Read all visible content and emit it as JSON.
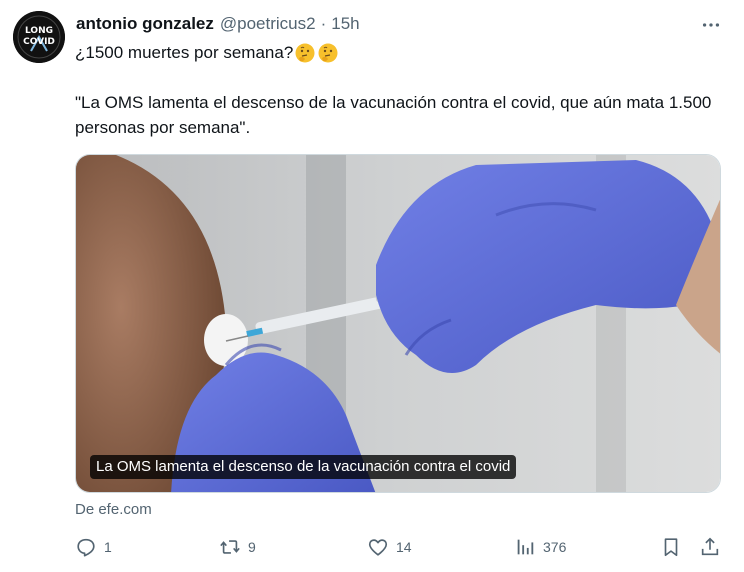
{
  "author": {
    "display_name": "antonio gonzalez",
    "handle": "@poetricus2",
    "separator": "·",
    "time": "15h",
    "avatar_lines": [
      "LONG",
      "COVID"
    ]
  },
  "tweet": {
    "line1": "¿1500 muertes por semana?",
    "line1_emojis": [
      "thinking-face",
      "thinking-face"
    ],
    "quote": "\"La OMS lamenta el descenso de la vacunación contra el covid, que aún mata 1.500 personas por semana\"."
  },
  "media": {
    "caption": "La OMS lamenta el descenso de la vacunación contra el covid",
    "source": "De efe.com"
  },
  "actions": {
    "reply_count": "1",
    "retweet_count": "9",
    "like_count": "14",
    "views_count": "376"
  },
  "icons": [
    "more-icon",
    "reply-icon",
    "retweet-icon",
    "like-icon",
    "views-icon",
    "bookmark-icon",
    "share-icon"
  ],
  "colors": {
    "text": "#0f1419",
    "secondary": "#536471",
    "glove": "#5b6cd9",
    "border": "#cfd9de"
  }
}
